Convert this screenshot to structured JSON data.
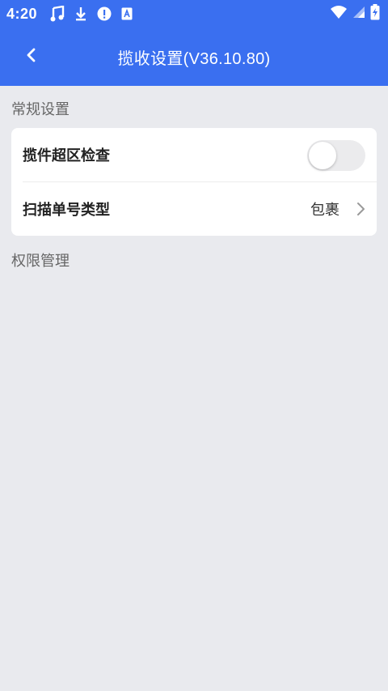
{
  "status_bar": {
    "time": "4:20",
    "icons": [
      "music-note-icon",
      "download-icon",
      "alert-icon",
      "keyboard-a-icon"
    ],
    "right_icons": [
      "wifi-icon",
      "signal-icon",
      "battery-charging-icon"
    ]
  },
  "header": {
    "title": "揽收设置(V36.10.80)",
    "back_icon": "chevron-left-icon",
    "color": "#3a6ff0"
  },
  "sections": {
    "general": {
      "title": "常规设置",
      "items": [
        {
          "label": "揽件超区检查",
          "control": "toggle",
          "state": "off"
        },
        {
          "label": "扫描单号类型",
          "value": "包裹",
          "control": "chevron"
        }
      ]
    },
    "permissions": {
      "title": "权限管理"
    }
  },
  "colors": {
    "background": "#e9eaee",
    "card": "#ffffff",
    "accent": "#3a6ff0"
  }
}
